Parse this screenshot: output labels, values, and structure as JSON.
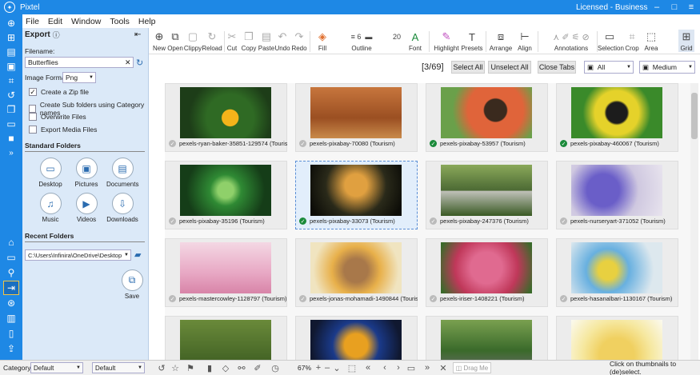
{
  "app": {
    "name": "Pixtel",
    "license": "Licensed - Business"
  },
  "menu": [
    "File",
    "Edit",
    "Window",
    "Tools",
    "Help"
  ],
  "toolbar": {
    "new": "New",
    "open": "Open",
    "clippy": "Clippy",
    "reload": "Reload",
    "cut": "Cut",
    "copy": "Copy",
    "paste": "Paste",
    "undo": "Undo",
    "redo": "Redo",
    "fill": "Fill",
    "outline": "Outline",
    "outline_width": "6",
    "font_size": "20",
    "font": "Font",
    "highlight": "Highlight",
    "presets": "Presets",
    "arrange": "Arrange",
    "align": "Align",
    "annotations": "Annotations",
    "selection": "Selection",
    "crop": "Crop",
    "area": "Area",
    "grid": "Grid"
  },
  "export": {
    "title": "Export",
    "filename_label": "Filename:",
    "filename": "Butterflies",
    "format_label": "Image Format:",
    "format": "Png",
    "options": [
      {
        "label": "Create a Zip file",
        "checked": true
      },
      {
        "label": "Create Sub folders using Category names",
        "checked": false
      },
      {
        "label": "Overwrite Files",
        "checked": false
      },
      {
        "label": "Export Media Files",
        "checked": false
      }
    ],
    "standard_folders_title": "Standard Folders",
    "folders": [
      "Desktop",
      "Pictures",
      "Documents",
      "Music",
      "Videos",
      "Downloads"
    ],
    "recent_title": "Recent Folders",
    "recent_path": "C:\\Users\\Infinira\\OneDrive\\Desktop",
    "save": "Save"
  },
  "controls": {
    "count": "[3/69]",
    "select_all": "Select All",
    "unselect_all": "Unselect All",
    "close_tabs": "Close Tabs",
    "filter": "All",
    "size": "Medium"
  },
  "thumbnails": [
    {
      "caption": "pexels-ryan-baker-35851-129574 (Tourism)",
      "checked": false
    },
    {
      "caption": "pexels-pixabay-70080 (Tourism)",
      "checked": false
    },
    {
      "caption": "pexels-pixabay-53957 (Tourism)",
      "checked": true
    },
    {
      "caption": "pexels-pixabay-460067 (Tourism)",
      "checked": true
    },
    {
      "caption": "pexels-pixabay-35196 (Tourism)",
      "checked": false
    },
    {
      "caption": "pexels-pixabay-33073 (Tourism)",
      "checked": true
    },
    {
      "caption": "pexels-pixabay-247376 (Tourism)",
      "checked": false
    },
    {
      "caption": "pexels-nurseryart-371052 (Tourism)",
      "checked": false
    },
    {
      "caption": "pexels-mastercowley-1128797 (Tourism)",
      "checked": false
    },
    {
      "caption": "pexels-jonas-mohamadi-1490844 (Tourism)",
      "checked": false
    },
    {
      "caption": "pexels-iriser-1408221 (Tourism)",
      "checked": false
    },
    {
      "caption": "pexels-hasanalbari-1130167 (Tourism)",
      "checked": false
    },
    {
      "caption": "",
      "checked": false
    },
    {
      "caption": "",
      "checked": false
    },
    {
      "caption": "",
      "checked": false
    },
    {
      "caption": "",
      "checked": false
    }
  ],
  "status": {
    "category_label": "Category",
    "cat1": "Default",
    "cat2": "Default",
    "zoom": "67%",
    "drag": "Drag Me",
    "hint": "Click on thumbnails to (de)select."
  }
}
